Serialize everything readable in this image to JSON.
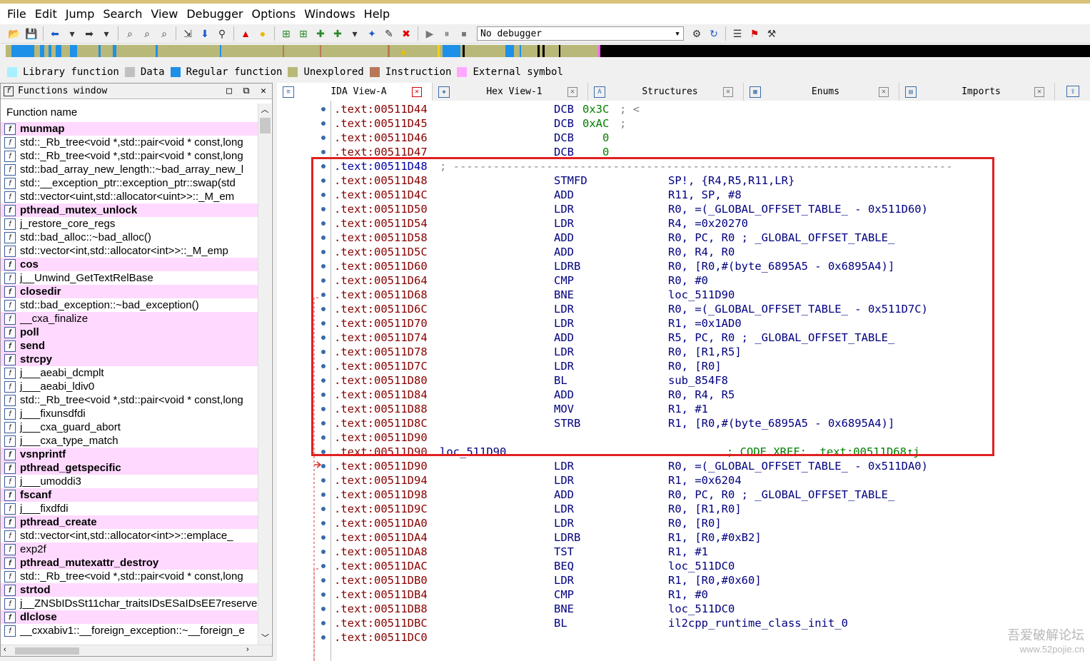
{
  "menu": [
    "File",
    "Edit",
    "Jump",
    "Search",
    "View",
    "Debugger",
    "Options",
    "Windows",
    "Help"
  ],
  "toolbar": {
    "debugger_select": "No debugger"
  },
  "legend": [
    {
      "label": "Library function",
      "color": "#a8f0ff"
    },
    {
      "label": "Data",
      "color": "#c0c0c0"
    },
    {
      "label": "Regular function",
      "color": "#1e90e8"
    },
    {
      "label": "Unexplored",
      "color": "#b8b878"
    },
    {
      "label": "Instruction",
      "color": "#b87858"
    },
    {
      "label": "External symbol",
      "color": "#ffa8ff"
    }
  ],
  "functions_window": {
    "title": "Functions window",
    "header": "Function name",
    "items": [
      {
        "name": "munmap",
        "lib": true
      },
      {
        "name": "std::_Rb_tree<void *,std::pair<void * const,long",
        "lib": false
      },
      {
        "name": "std::_Rb_tree<void *,std::pair<void * const,long",
        "lib": false
      },
      {
        "name": "std::bad_array_new_length::~bad_array_new_l",
        "lib": false
      },
      {
        "name": "std::__exception_ptr::exception_ptr::swap(std",
        "lib": false
      },
      {
        "name": "std::vector<uint,std::allocator<uint>>::_M_em",
        "lib": false
      },
      {
        "name": "pthread_mutex_unlock",
        "lib": true
      },
      {
        "name": "j_restore_core_regs",
        "lib": false
      },
      {
        "name": "std::bad_alloc::~bad_alloc()",
        "lib": false
      },
      {
        "name": "std::vector<int,std::allocator<int>>::_M_emp",
        "lib": false
      },
      {
        "name": "cos",
        "lib": true
      },
      {
        "name": "j__Unwind_GetTextRelBase",
        "lib": false
      },
      {
        "name": "closedir",
        "lib": true
      },
      {
        "name": "std::bad_exception::~bad_exception()",
        "lib": false
      },
      {
        "name": "__cxa_finalize",
        "lib": true,
        "plain": true
      },
      {
        "name": "poll",
        "lib": true
      },
      {
        "name": "send",
        "lib": true
      },
      {
        "name": "strcpy",
        "lib": true
      },
      {
        "name": "j___aeabi_dcmplt",
        "lib": false
      },
      {
        "name": "j___aeabi_ldiv0",
        "lib": false
      },
      {
        "name": "std::_Rb_tree<void *,std::pair<void * const,long",
        "lib": false
      },
      {
        "name": "j___fixunsdfdi",
        "lib": false
      },
      {
        "name": "j___cxa_guard_abort",
        "lib": false
      },
      {
        "name": "j___cxa_type_match",
        "lib": false
      },
      {
        "name": "vsnprintf",
        "lib": true
      },
      {
        "name": "pthread_getspecific",
        "lib": true
      },
      {
        "name": "j___umoddi3",
        "lib": false
      },
      {
        "name": "fscanf",
        "lib": true
      },
      {
        "name": "j___fixdfdi",
        "lib": false
      },
      {
        "name": "pthread_create",
        "lib": true
      },
      {
        "name": "std::vector<int,std::allocator<int>>::emplace_",
        "lib": false
      },
      {
        "name": "exp2f",
        "lib": true,
        "plain": true
      },
      {
        "name": "pthread_mutexattr_destroy",
        "lib": true
      },
      {
        "name": "std::_Rb_tree<void *,std::pair<void * const,long",
        "lib": false
      },
      {
        "name": "strtod",
        "lib": true
      },
      {
        "name": "j__ZNSbIDsSt11char_traitsIDsESaIDsEE7reserve",
        "lib": false
      },
      {
        "name": "dlclose",
        "lib": true
      },
      {
        "name": "__cxxabiv1::__foreign_exception::~__foreign_e",
        "lib": false
      }
    ]
  },
  "tabs": [
    {
      "label": "IDA View-A",
      "active": true
    },
    {
      "label": "Hex View-1",
      "active": false
    },
    {
      "label": "Structures",
      "active": false
    },
    {
      "label": "Enums",
      "active": false
    },
    {
      "label": "Imports",
      "active": false
    }
  ],
  "disasm": [
    {
      "addr": ".text:00511D44",
      "mn": "DCB",
      "op": "0x3C",
      "cm": "; <",
      "kind": "dcb"
    },
    {
      "addr": ".text:00511D45",
      "mn": "DCB",
      "op": "0xAC",
      "cm": ";",
      "kind": "dcb"
    },
    {
      "addr": ".text:00511D46",
      "mn": "DCB",
      "op": "   0",
      "cm": "",
      "kind": "dcb"
    },
    {
      "addr": ".text:00511D47",
      "mn": "DCB",
      "op": "   0",
      "cm": "",
      "kind": "dcb"
    },
    {
      "addr": ".text:00511D48",
      "kind": "sep",
      "text": "; ---------------------------------------------------------------------------"
    },
    {
      "addr": ".text:00511D48",
      "mn": "STMFD",
      "op": "SP!, {R4,R5,R11,LR}"
    },
    {
      "addr": ".text:00511D4C",
      "mn": "ADD",
      "op": "R11, SP, #8"
    },
    {
      "addr": ".text:00511D50",
      "mn": "LDR",
      "op": "R0, =(_GLOBAL_OFFSET_TABLE_ - 0x511D60)"
    },
    {
      "addr": ".text:00511D54",
      "mn": "LDR",
      "op": "R4, =0x20270"
    },
    {
      "addr": ".text:00511D58",
      "mn": "ADD",
      "op": "R0, PC, R0 ; _GLOBAL_OFFSET_TABLE_"
    },
    {
      "addr": ".text:00511D5C",
      "mn": "ADD",
      "op": "R0, R4, R0"
    },
    {
      "addr": ".text:00511D60",
      "mn": "LDRB",
      "op": "R0, [R0,#(byte_6895A5 - 0x6895A4)]"
    },
    {
      "addr": ".text:00511D64",
      "mn": "CMP",
      "op": "R0, #0"
    },
    {
      "addr": ".text:00511D68",
      "mn": "BNE",
      "op": "loc_511D90"
    },
    {
      "addr": ".text:00511D6C",
      "mn": "LDR",
      "op": "R0, =(_GLOBAL_OFFSET_TABLE_ - 0x511D7C)"
    },
    {
      "addr": ".text:00511D70",
      "mn": "LDR",
      "op": "R1, =0x1AD0"
    },
    {
      "addr": ".text:00511D74",
      "mn": "ADD",
      "op": "R5, PC, R0 ; _GLOBAL_OFFSET_TABLE_"
    },
    {
      "addr": ".text:00511D78",
      "mn": "LDR",
      "op": "R0, [R1,R5]"
    },
    {
      "addr": ".text:00511D7C",
      "mn": "LDR",
      "op": "R0, [R0]"
    },
    {
      "addr": ".text:00511D80",
      "mn": "BL",
      "op": "sub_854F8"
    },
    {
      "addr": ".text:00511D84",
      "mn": "ADD",
      "op": "R0, R4, R5"
    },
    {
      "addr": ".text:00511D88",
      "mn": "MOV",
      "op": "R1, #1"
    },
    {
      "addr": ".text:00511D8C",
      "mn": "STRB",
      "op": "R1, [R0,#(byte_6895A5 - 0x6895A4)]"
    },
    {
      "addr": ".text:00511D90",
      "kind": "blank"
    },
    {
      "addr": ".text:00511D90",
      "kind": "label",
      "label": "loc_511D90",
      "xref": "; CODE XREF: .text:00511D68↑j"
    },
    {
      "addr": ".text:00511D90",
      "mn": "LDR",
      "op": "R0, =(_GLOBAL_OFFSET_TABLE_ - 0x511DA0)"
    },
    {
      "addr": ".text:00511D94",
      "mn": "LDR",
      "op": "R1, =0x6204"
    },
    {
      "addr": ".text:00511D98",
      "mn": "ADD",
      "op": "R0, PC, R0 ; _GLOBAL_OFFSET_TABLE_"
    },
    {
      "addr": ".text:00511D9C",
      "mn": "LDR",
      "op": "R0, [R1,R0]"
    },
    {
      "addr": ".text:00511DA0",
      "mn": "LDR",
      "op": "R0, [R0]"
    },
    {
      "addr": ".text:00511DA4",
      "mn": "LDRB",
      "op": "R1, [R0,#0xB2]"
    },
    {
      "addr": ".text:00511DA8",
      "mn": "TST",
      "op": "R1, #1"
    },
    {
      "addr": ".text:00511DAC",
      "mn": "BEQ",
      "op": "loc_511DC0"
    },
    {
      "addr": ".text:00511DB0",
      "mn": "LDR",
      "op": "R1, [R0,#0x60]"
    },
    {
      "addr": ".text:00511DB4",
      "mn": "CMP",
      "op": "R1, #0"
    },
    {
      "addr": ".text:00511DB8",
      "mn": "BNE",
      "op": "loc_511DC0"
    },
    {
      "addr": ".text:00511DBC",
      "mn": "BL",
      "op": "il2cpp_runtime_class_init_0"
    },
    {
      "addr": ".text:00511DC0",
      "kind": "blank"
    }
  ],
  "watermark": {
    "line1": "吾爱破解论坛",
    "line2": "www.52pojie.cn"
  }
}
